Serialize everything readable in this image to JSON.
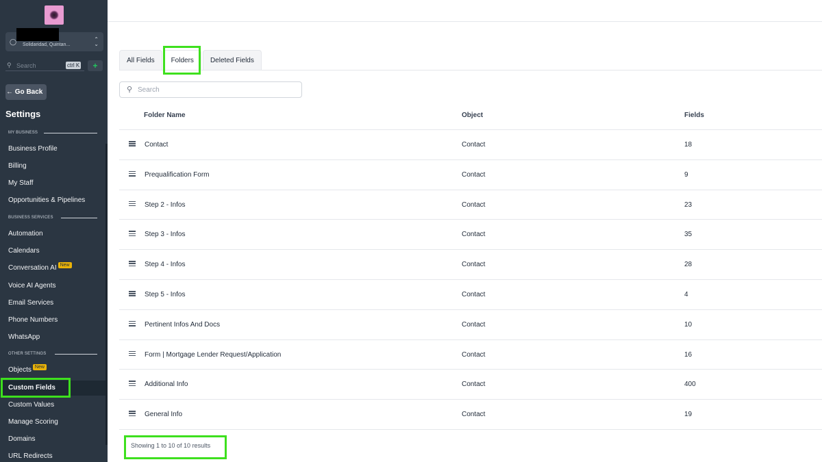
{
  "sidebar": {
    "account_name": "Solidaridad, Quintan...",
    "search_placeholder": "Search",
    "search_shortcut": "ctrl K",
    "go_back_label": "← Go Back",
    "settings_title": "Settings",
    "sections": {
      "my_business": "MY BUSINESS",
      "business_services": "BUSINESS SERVICES",
      "other_settings": "OTHER SETTINGS"
    },
    "items": [
      {
        "label": "Business Profile"
      },
      {
        "label": "Billing"
      },
      {
        "label": "My Staff"
      },
      {
        "label": "Opportunities & Pipelines"
      },
      {
        "label": "Automation"
      },
      {
        "label": "Calendars"
      },
      {
        "label": "Conversation AI",
        "badge": "New"
      },
      {
        "label": "Voice AI Agents"
      },
      {
        "label": "Email Services"
      },
      {
        "label": "Phone Numbers"
      },
      {
        "label": "WhatsApp"
      },
      {
        "label": "Objects",
        "badge": "New"
      },
      {
        "label": "Custom Fields",
        "active": true
      },
      {
        "label": "Custom Values"
      },
      {
        "label": "Manage Scoring"
      },
      {
        "label": "Domains"
      },
      {
        "label": "URL Redirects"
      }
    ]
  },
  "tabs": [
    {
      "label": "All Fields"
    },
    {
      "label": "Folders",
      "active": true
    },
    {
      "label": "Deleted Fields"
    }
  ],
  "search": {
    "placeholder": "Search"
  },
  "table": {
    "headers": {
      "folder_name": "Folder Name",
      "object": "Object",
      "fields": "Fields"
    },
    "rows": [
      {
        "folder_name": "Contact",
        "object": "Contact",
        "fields": "18"
      },
      {
        "folder_name": "Prequalification Form",
        "object": "Contact",
        "fields": "9"
      },
      {
        "folder_name": "Step 2 - Infos",
        "object": "Contact",
        "fields": "23"
      },
      {
        "folder_name": "Step 3 - Infos",
        "object": "Contact",
        "fields": "35"
      },
      {
        "folder_name": "Step 4 - Infos",
        "object": "Contact",
        "fields": "28"
      },
      {
        "folder_name": "Step 5 - Infos",
        "object": "Contact",
        "fields": "4"
      },
      {
        "folder_name": "Pertinent Infos And Docs",
        "object": "Contact",
        "fields": "10"
      },
      {
        "folder_name": "Form | Mortgage Lender Request/Application",
        "object": "Contact",
        "fields": "16"
      },
      {
        "folder_name": "Additional Info",
        "object": "Contact",
        "fields": "400"
      },
      {
        "folder_name": "General Info",
        "object": "Contact",
        "fields": "19"
      }
    ]
  },
  "pagination": {
    "summary": "Showing 1 to 10 of 10 results"
  },
  "colors": {
    "sidebar_bg": "#2b3642",
    "highlight": "#3ee01e",
    "badge": "#eab308"
  }
}
